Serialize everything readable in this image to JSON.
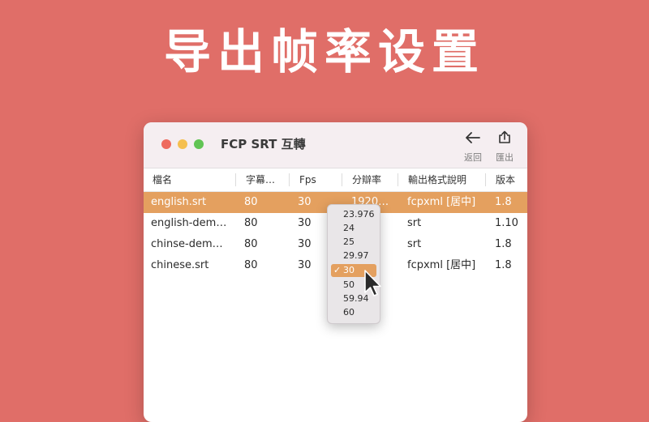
{
  "hero": {
    "title": "导出帧率设置"
  },
  "window": {
    "title": "FCP SRT 互轉",
    "toolbar": {
      "back_label": "返回",
      "export_label": "匯出",
      "back_icon": "arrow-left-icon",
      "export_icon": "share-icon"
    }
  },
  "table": {
    "columns": [
      "檔名",
      "字幕…",
      "Fps",
      "分辯率",
      "輸出格式說明",
      "版本"
    ],
    "rows": [
      {
        "name": "english.srt",
        "subtitles": "80",
        "fps": "30",
        "resolution": "1920…",
        "format": "fcpxml [居中]",
        "version": "1.8",
        "selected": true
      },
      {
        "name": "english-dem…",
        "subtitles": "80",
        "fps": "30",
        "resolution": "",
        "format": "srt",
        "version": "1.10",
        "selected": false
      },
      {
        "name": "chinse-dem…",
        "subtitles": "80",
        "fps": "30",
        "resolution": "",
        "format": "srt",
        "version": "1.8",
        "selected": false
      },
      {
        "name": "chinese.srt",
        "subtitles": "80",
        "fps": "30",
        "resolution": "",
        "format": "fcpxml [居中]",
        "version": "1.8",
        "selected": false
      }
    ]
  },
  "fps_menu": {
    "options": [
      "23.976",
      "24",
      "25",
      "29.97",
      "30",
      "50",
      "59.94",
      "60"
    ],
    "selected": "30",
    "check_mark": "✓"
  },
  "colors": {
    "background": "#e06e68",
    "selection": "#e4a05f"
  }
}
